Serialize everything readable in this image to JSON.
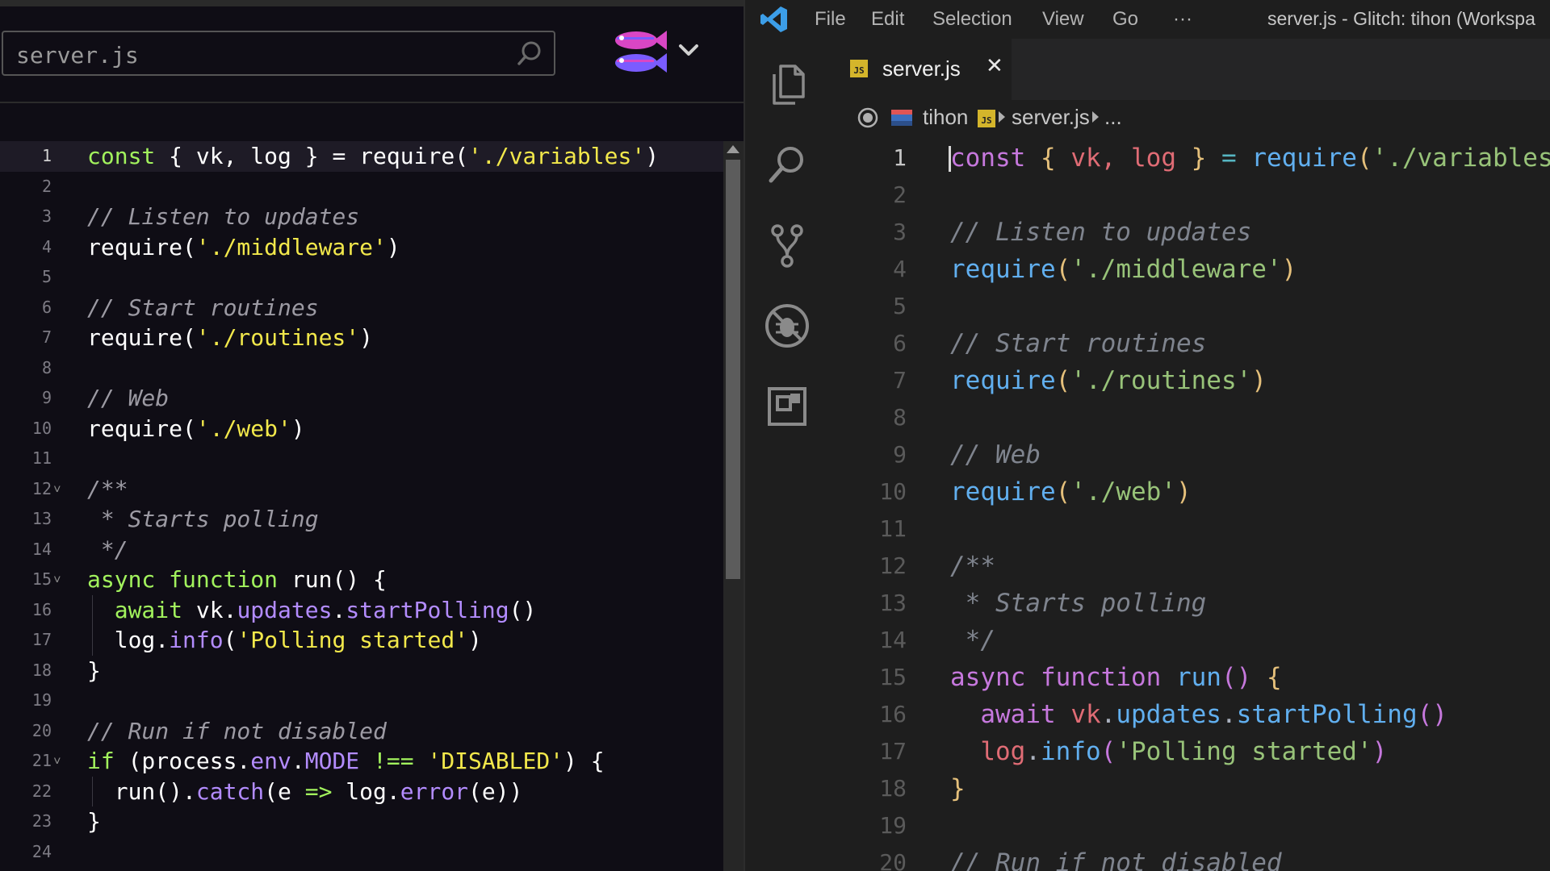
{
  "glitch": {
    "file_search_value": "server.js",
    "code_lines": [
      [
        {
          "t": "const",
          "c": "gk"
        },
        {
          "t": " { vk, log } = ",
          "c": "gt"
        },
        {
          "t": "require",
          "c": "gt"
        },
        {
          "t": "(",
          "c": "gt"
        },
        {
          "t": "'./variables'",
          "c": "gs"
        },
        {
          "t": ")",
          "c": "gt"
        }
      ],
      [],
      [
        {
          "t": "// Listen to updates",
          "c": "gc"
        }
      ],
      [
        {
          "t": "require(",
          "c": "gt"
        },
        {
          "t": "'./middleware'",
          "c": "gs"
        },
        {
          "t": ")",
          "c": "gt"
        }
      ],
      [],
      [
        {
          "t": "// Start routines",
          "c": "gc"
        }
      ],
      [
        {
          "t": "require(",
          "c": "gt"
        },
        {
          "t": "'./routines'",
          "c": "gs"
        },
        {
          "t": ")",
          "c": "gt"
        }
      ],
      [],
      [
        {
          "t": "// Web",
          "c": "gc"
        }
      ],
      [
        {
          "t": "require(",
          "c": "gt"
        },
        {
          "t": "'./web'",
          "c": "gs"
        },
        {
          "t": ")",
          "c": "gt"
        }
      ],
      [],
      [
        {
          "t": "/**",
          "c": "gc"
        }
      ],
      [
        {
          "t": " * Starts polling",
          "c": "gc"
        }
      ],
      [
        {
          "t": " */",
          "c": "gc"
        }
      ],
      [
        {
          "t": "async",
          "c": "gk"
        },
        {
          "t": " ",
          "c": "gt"
        },
        {
          "t": "function",
          "c": "gk"
        },
        {
          "t": " run() {",
          "c": "gt"
        }
      ],
      [
        {
          "t": "  ",
          "c": "gt"
        },
        {
          "t": "await",
          "c": "gk"
        },
        {
          "t": " vk.",
          "c": "gt"
        },
        {
          "t": "updates",
          "c": "gm"
        },
        {
          "t": ".",
          "c": "gt"
        },
        {
          "t": "startPolling",
          "c": "gm"
        },
        {
          "t": "()",
          "c": "gt"
        }
      ],
      [
        {
          "t": "  log.",
          "c": "gt"
        },
        {
          "t": "info",
          "c": "gm"
        },
        {
          "t": "(",
          "c": "gt"
        },
        {
          "t": "'Polling started'",
          "c": "gs"
        },
        {
          "t": ")",
          "c": "gt"
        }
      ],
      [
        {
          "t": "}",
          "c": "gt"
        }
      ],
      [],
      [
        {
          "t": "// Run if not disabled",
          "c": "gc"
        }
      ],
      [
        {
          "t": "if",
          "c": "gk"
        },
        {
          "t": " (process.",
          "c": "gt"
        },
        {
          "t": "env",
          "c": "gm"
        },
        {
          "t": ".",
          "c": "gt"
        },
        {
          "t": "MODE",
          "c": "gm"
        },
        {
          "t": " ",
          "c": "gt"
        },
        {
          "t": "!==",
          "c": "gk"
        },
        {
          "t": " ",
          "c": "gt"
        },
        {
          "t": "'DISABLED'",
          "c": "gs"
        },
        {
          "t": ") {",
          "c": "gt"
        }
      ],
      [
        {
          "t": "  run().",
          "c": "gt"
        },
        {
          "t": "catch",
          "c": "gm"
        },
        {
          "t": "(e ",
          "c": "gt"
        },
        {
          "t": "=>",
          "c": "gk"
        },
        {
          "t": " log.",
          "c": "gt"
        },
        {
          "t": "error",
          "c": "gm"
        },
        {
          "t": "(e))",
          "c": "gt"
        }
      ],
      [
        {
          "t": "}",
          "c": "gt"
        }
      ],
      []
    ]
  },
  "vscode": {
    "menu": [
      "File",
      "Edit",
      "Selection",
      "View",
      "Go",
      "···"
    ],
    "window_title": "server.js - Glitch: tihon (Workspa",
    "tab": {
      "label": "server.js",
      "badge": "JS",
      "close": "✕"
    },
    "breadcrumb": {
      "folder": "tihon",
      "file": "server.js",
      "more": "..."
    },
    "code_lines": [
      [
        {
          "t": "const",
          "c": "vk"
        },
        {
          "t": " ",
          "c": "vt"
        },
        {
          "t": "{",
          "c": "vb"
        },
        {
          "t": " vk, log ",
          "c": "vr"
        },
        {
          "t": "}",
          "c": "vb"
        },
        {
          "t": " = ",
          "c": "vo"
        },
        {
          "t": "require",
          "c": "vf"
        },
        {
          "t": "(",
          "c": "vb"
        },
        {
          "t": "'./variables",
          "c": "vs"
        }
      ],
      [],
      [
        {
          "t": "// Listen to updates",
          "c": "vc"
        }
      ],
      [
        {
          "t": "require",
          "c": "vf"
        },
        {
          "t": "(",
          "c": "vb"
        },
        {
          "t": "'./middleware'",
          "c": "vs"
        },
        {
          "t": ")",
          "c": "vb"
        }
      ],
      [],
      [
        {
          "t": "// Start routines",
          "c": "vc"
        }
      ],
      [
        {
          "t": "require",
          "c": "vf"
        },
        {
          "t": "(",
          "c": "vb"
        },
        {
          "t": "'./routines'",
          "c": "vs"
        },
        {
          "t": ")",
          "c": "vb"
        }
      ],
      [],
      [
        {
          "t": "// Web",
          "c": "vc"
        }
      ],
      [
        {
          "t": "require",
          "c": "vf"
        },
        {
          "t": "(",
          "c": "vb"
        },
        {
          "t": "'./web'",
          "c": "vs"
        },
        {
          "t": ")",
          "c": "vb"
        }
      ],
      [],
      [
        {
          "t": "/**",
          "c": "vc"
        }
      ],
      [
        {
          "t": " * Starts polling",
          "c": "vc"
        }
      ],
      [
        {
          "t": " */",
          "c": "vc"
        }
      ],
      [
        {
          "t": "async",
          "c": "vk"
        },
        {
          "t": " ",
          "c": "vt"
        },
        {
          "t": "function",
          "c": "vk"
        },
        {
          "t": " ",
          "c": "vt"
        },
        {
          "t": "run",
          "c": "vf"
        },
        {
          "t": "() ",
          "c": "vp"
        },
        {
          "t": "{",
          "c": "vb"
        }
      ],
      [
        {
          "t": "  ",
          "c": "vt"
        },
        {
          "t": "await",
          "c": "vk"
        },
        {
          "t": " vk",
          "c": "vr"
        },
        {
          "t": ".",
          "c": "vt"
        },
        {
          "t": "updates",
          "c": "vf"
        },
        {
          "t": ".",
          "c": "vt"
        },
        {
          "t": "startPolling",
          "c": "vf"
        },
        {
          "t": "()",
          "c": "vp"
        }
      ],
      [
        {
          "t": "  ",
          "c": "vt"
        },
        {
          "t": "log",
          "c": "vr"
        },
        {
          "t": ".",
          "c": "vt"
        },
        {
          "t": "info",
          "c": "vf"
        },
        {
          "t": "(",
          "c": "vp"
        },
        {
          "t": "'Polling started'",
          "c": "vs"
        },
        {
          "t": ")",
          "c": "vp"
        }
      ],
      [
        {
          "t": "}",
          "c": "vb"
        }
      ],
      [],
      [
        {
          "t": "// Run if not disabled",
          "c": "vc"
        }
      ]
    ]
  },
  "colors": {
    "glitch_bg": "#0f0d15",
    "vscode_bg": "#1e1e1e",
    "vscode_accent": "#3c9ee8",
    "js_badge": "#d4b52b"
  }
}
